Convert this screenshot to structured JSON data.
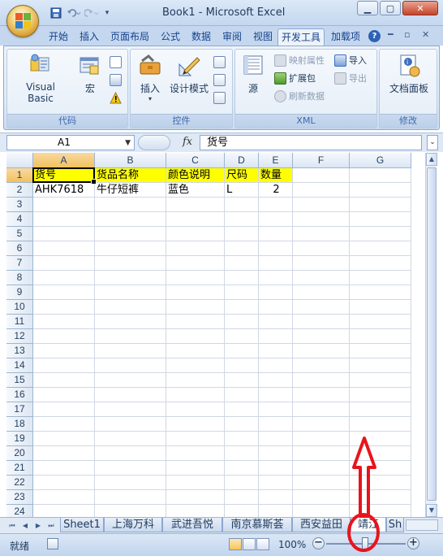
{
  "window": {
    "title": "Book1 - Microsoft Excel",
    "qat_icons": [
      "save-icon",
      "undo-icon",
      "redo-icon",
      "customize-icon"
    ]
  },
  "ribbon_tabs": [
    {
      "label": "开始",
      "active": false
    },
    {
      "label": "插入",
      "active": false
    },
    {
      "label": "页面布局",
      "active": false
    },
    {
      "label": "公式",
      "active": false
    },
    {
      "label": "数据",
      "active": false
    },
    {
      "label": "审阅",
      "active": false
    },
    {
      "label": "视图",
      "active": false
    },
    {
      "label": "开发工具",
      "active": true
    },
    {
      "label": "加载项",
      "active": false
    }
  ],
  "ribbon": {
    "code": {
      "label": "代码",
      "visual_basic": "Visual Basic",
      "macro": "宏"
    },
    "controls": {
      "label": "控件",
      "insert": "插入",
      "design_mode": "设计模式"
    },
    "xml": {
      "label": "XML",
      "source": "源",
      "map_properties": "映射属性",
      "expansion_pack": "扩展包",
      "refresh_data": "刷新数据",
      "import": "导入",
      "export": "导出"
    },
    "modify": {
      "label": "修改",
      "document_panel": "文档面板"
    }
  },
  "formula_bar": {
    "name_box": "A1",
    "fx": "fx",
    "content": "货号"
  },
  "sheet": {
    "columns": [
      "A",
      "B",
      "C",
      "D",
      "E",
      "F",
      "G"
    ],
    "rows": [
      "1",
      "2",
      "3",
      "4",
      "5",
      "6",
      "7",
      "8",
      "9",
      "10",
      "11",
      "12",
      "13",
      "14",
      "15",
      "16",
      "17",
      "18",
      "19",
      "20",
      "21",
      "22",
      "23",
      "24"
    ],
    "row1": [
      "货号",
      "货品名称",
      "颜色说明",
      "尺码",
      "数量"
    ],
    "row2": [
      "AHK7618",
      "牛仔短裤",
      "蓝色",
      "L",
      "2"
    ],
    "header_fill": "#ffff00"
  },
  "sheet_tabs": [
    {
      "label": "Sheet1",
      "active": false
    },
    {
      "label": "上海万科",
      "active": false
    },
    {
      "label": "武进吾悦",
      "active": false
    },
    {
      "label": "南京慕斯荟",
      "active": false
    },
    {
      "label": "西安益田",
      "active": false
    },
    {
      "label": "靖江",
      "active": true
    },
    {
      "label": "Sh",
      "active": false
    }
  ],
  "status": {
    "ready": "就绪",
    "zoom": "100%"
  },
  "annotation_color": "#e8141c"
}
